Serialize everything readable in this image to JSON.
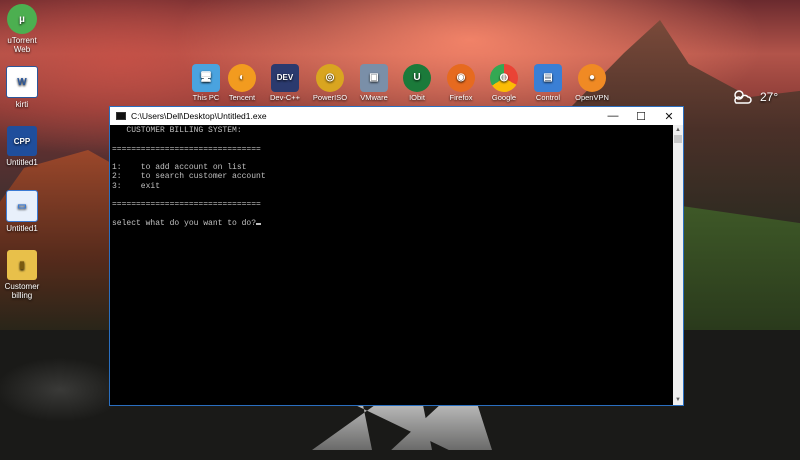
{
  "desktop": {
    "left_icons": [
      {
        "label": "uTorrent\nWeb",
        "icon": "utorrent-icon",
        "glyph": "µ",
        "color": "#4caf50"
      },
      {
        "label": "kirti",
        "icon": "word-document-icon",
        "glyph": "W",
        "color": "#2b579a"
      },
      {
        "label": "Untitled1",
        "icon": "cpp-file-icon",
        "glyph": "CPP",
        "color": "#1f4e9c"
      },
      {
        "label": "Untitled1",
        "icon": "exe-file-icon",
        "glyph": "▭",
        "color": "#3b7bd4"
      },
      {
        "label": "Customer\nbilling",
        "icon": "zip-folder-icon",
        "glyph": "▮",
        "color": "#e8c04a"
      }
    ],
    "top_icons": [
      {
        "label": "This PC",
        "icon": "computer-icon",
        "glyph": "🖥",
        "color": "#4aa3df"
      },
      {
        "label": "Tencent",
        "icon": "tencent-icon",
        "glyph": "◐",
        "color": "#f29b1f"
      },
      {
        "label": "Dev-C++",
        "icon": "devcpp-icon",
        "glyph": "DEV",
        "color": "#2b3a6e"
      },
      {
        "label": "PowerISO",
        "icon": "poweriso-icon",
        "glyph": "◎",
        "color": "#d9a520"
      },
      {
        "label": "VMware",
        "icon": "vmware-icon",
        "glyph": "▣",
        "color": "#7a8fa8"
      },
      {
        "label": "IObit",
        "icon": "iobit-icon",
        "glyph": "U",
        "color": "#1b7a3a"
      },
      {
        "label": "Firefox",
        "icon": "firefox-icon",
        "glyph": "◉",
        "color": "#e66a1f"
      },
      {
        "label": "Google",
        "icon": "chrome-icon",
        "glyph": "◍",
        "color": "#34a853"
      },
      {
        "label": "Control",
        "icon": "control-panel-icon",
        "glyph": "▤",
        "color": "#3a7fd5"
      },
      {
        "label": "OpenVPN",
        "icon": "openvpn-icon",
        "glyph": "●",
        "color": "#f08a24"
      }
    ],
    "weather": {
      "icon": "partly-cloudy-icon",
      "temp": "27°"
    }
  },
  "window": {
    "title": "C:\\Users\\Dell\\Desktop\\Untitled1.exe",
    "minimize": "—",
    "maximize": "☐",
    "close": "✕",
    "console_lines": [
      "   CUSTOMER BILLING SYSTEM:",
      "",
      "===============================",
      "",
      "1:    to add account on list",
      "2:    to search customer account",
      "3:    exit",
      "",
      "===============================",
      "",
      "select what do you want to do?"
    ]
  }
}
